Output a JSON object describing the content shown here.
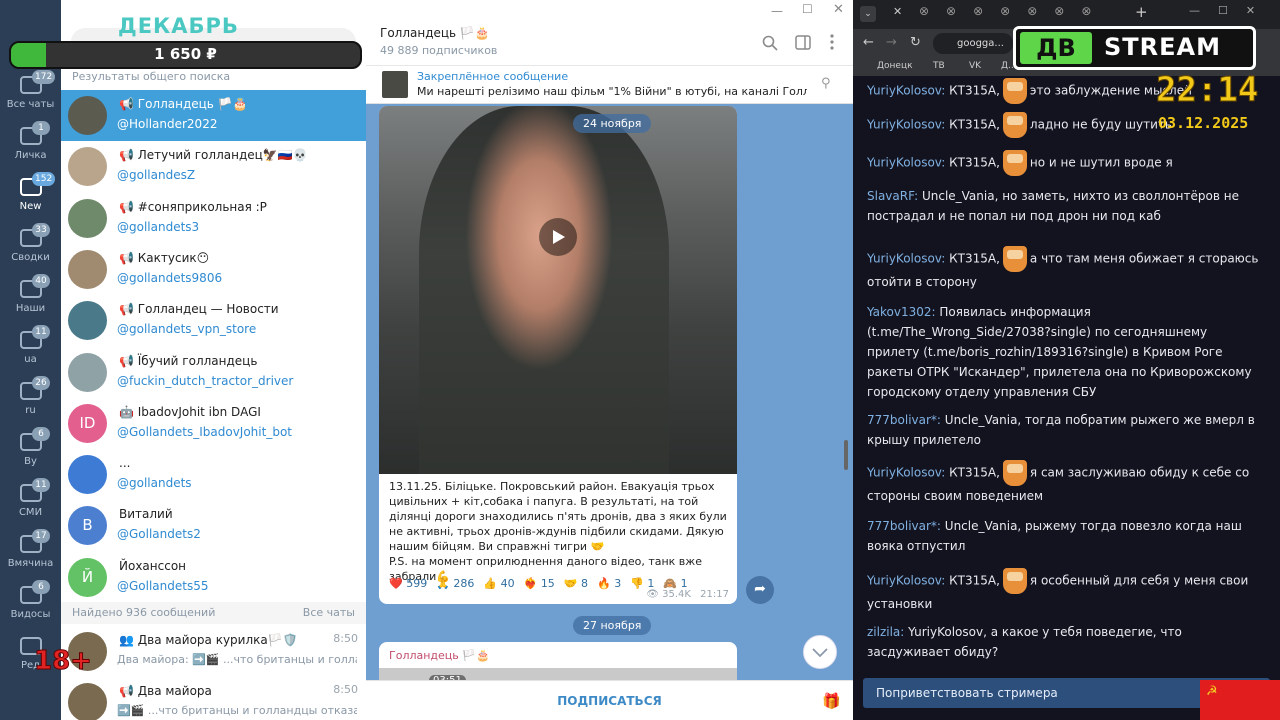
{
  "overlay": {
    "month": "ДЕКАБРЬ",
    "amount": "1 650 ₽",
    "age": "18+"
  },
  "stream": {
    "logo": "ДВ",
    "logo2": "STREAM",
    "time": "22:14",
    "date": "03.12.2025"
  },
  "folders": [
    {
      "label": "Все чаты",
      "badge": "172"
    },
    {
      "label": "Личка",
      "badge": "1"
    },
    {
      "label": "New",
      "badge": "152"
    },
    {
      "label": "Сводки",
      "badge": "33"
    },
    {
      "label": "Наши",
      "badge": "40"
    },
    {
      "label": "ua",
      "badge": "11"
    },
    {
      "label": "ru",
      "badge": "26"
    },
    {
      "label": "By",
      "badge": "6"
    },
    {
      "label": "СМИ",
      "badge": "11"
    },
    {
      "label": "Вмячина",
      "badge": "17"
    },
    {
      "label": "Видосы",
      "badge": "6"
    },
    {
      "label": "Ред",
      "badge": ""
    }
  ],
  "search": {
    "results_header": "Результаты общего поиска",
    "found_header": "Найдено 936 сообщений",
    "found_filter": "Все чаты"
  },
  "chats": [
    {
      "name": "📢 Голландець 🏳️🎂",
      "user": "@Hollander2022",
      "av": "#5b5b50"
    },
    {
      "name": "📢 Летучий голландец🦅🇷🇺💀",
      "user": "@gollandesZ",
      "av": "#b8a58c"
    },
    {
      "name": "📢 #соняприкольная :P",
      "user": "@gollandets3",
      "av": "#6f8a6a"
    },
    {
      "name": "📢 Кактусик😶",
      "user": "@gollandets9806",
      "av": "#a08a70"
    },
    {
      "name": "📢 Голландец — Новости",
      "user": "@gollandets_vpn_store",
      "av": "#4a7a8a"
    },
    {
      "name": "📢 Їбучий голландець",
      "user": "@fuckin_dutch_tractor_driver",
      "av": "#8fa2a6"
    },
    {
      "name": "🤖 IbadovJohit ibn DAGI",
      "user": "@Gollandets_IbadovJohit_bot",
      "av": "#e25f8e",
      "letter": "ID"
    },
    {
      "name": "...",
      "user": "@gollandets",
      "av": "#3d7bd4",
      "letter": ""
    },
    {
      "name": "Виталий",
      "user": "@Gollandets2",
      "av": "#4c7fd0",
      "letter": "В"
    },
    {
      "name": "Йоханссон",
      "user": "@Gollandets55",
      "av": "#62c265",
      "letter": "Й"
    }
  ],
  "results": [
    {
      "name": "👥 Два майора курилка🏳️🛡️",
      "time": "8:50",
      "snippet": "Два майора: ➡️🎬 ...что британцы и голланд..."
    },
    {
      "name": "📢 Два майора",
      "time": "8:50",
      "snippet": "➡️🎬 ...что британцы и голландцы отказали..."
    }
  ],
  "channel": {
    "title": "Голландець 🏳️🎂",
    "subs": "49 889 подписчиков",
    "pinned_title": "Закреплённое сообщение",
    "pinned_text": "Ми нарешті релізимо наш фільм \"1% Війни\" в  ютубі, на каналі Голландец...",
    "date1": "24 ноября",
    "date2": "27 ноября",
    "subscribe": "ПОДПИСАТЬСЯ",
    "next_author": "Голландець 🏳️🎂",
    "next_dur": "03:51"
  },
  "post": {
    "text": "13.11.25. Біліцьке. Покровський район. Евакуація трьох цивільних + кіт,собака і папуга. В результаті, на той ділянці дороги знаходились п'ять дронів, два з яких були не активні, трьох дронів-ждунів підбили скидами. Дякую нашим бійцям. Ви справжні тигри 🤝\nP.S. на момент оприлюднення даного відео, танк вже забрали💪",
    "reactions": [
      [
        "❤️",
        "599"
      ],
      [
        "🙏",
        "286"
      ],
      [
        "👍",
        "40"
      ],
      [
        "❤️‍🔥",
        "15"
      ],
      [
        "🤝",
        "8"
      ],
      [
        "🔥",
        "3"
      ],
      [
        "👎",
        "1"
      ],
      [
        "🙈",
        "1"
      ]
    ],
    "views": "👁 35.4K",
    "time": "21:17"
  },
  "browser": {
    "url": "googga...",
    "bookmarks": [
      "Донецк",
      "ТВ",
      "VK",
      "Д..."
    ]
  },
  "messages": [
    {
      "u": "YuriyKolosov:",
      "to": "КТ315А,",
      "face": true,
      "t": "это заблуждение мыслей"
    },
    {
      "u": "YuriyKolosov:",
      "to": "КТ315А,",
      "face": true,
      "t": "ладно не буду шутить"
    },
    {
      "u": "YuriyKolosov:",
      "to": "КТ315А,",
      "face": true,
      "t": "но и не шутил вроде я"
    },
    {
      "u": "SlavaRF:",
      "to": "",
      "face": false,
      "t": "Uncle_Vania, но заметь, нихто из своллонтёров не пострадал и не попал ни под дрон ни под каб"
    },
    {
      "u": "YuriyKolosov:",
      "to": "КТ315А,",
      "face": true,
      "t": "а что там меня обижает я стораюсь отойти в сторону"
    },
    {
      "u": "Yakov1302:",
      "to": "",
      "face": false,
      "t": "Появилась информация (t.me/The_Wrong_Side/27038?single) по сегодняшнему прилету (t.me/boris_rozhin/189316?single) в Кривом Роге ракеты ОТРК \"Искандер\", прилетела она по Криворожскому городскому отделу управления СБУ"
    },
    {
      "u": "777bolivar*:",
      "to": "",
      "face": false,
      "t": "Uncle_Vania, тогда побратим рыжего же вмерл в крышу прилетело"
    },
    {
      "u": "YuriyKolosov:",
      "to": "КТ315А,",
      "face": true,
      "t": "я сам заслуживаю обиду к себе со стороны своим поведением"
    },
    {
      "u": "777bolivar*:",
      "to": "",
      "face": false,
      "t": "Uncle_Vania, рыжему тогда повезло когда наш вояка отпустил"
    },
    {
      "u": "YuriyKolosov:",
      "to": "КТ315А,",
      "face": true,
      "t": "я особенный для себя у меня свои установки"
    },
    {
      "u": "zilzila:",
      "to": "",
      "face": false,
      "t": "YuriyKolosov, а какое у тебя поведегие, что засдуживает обиду?"
    }
  ],
  "greet": "Поприветствовать стримера"
}
